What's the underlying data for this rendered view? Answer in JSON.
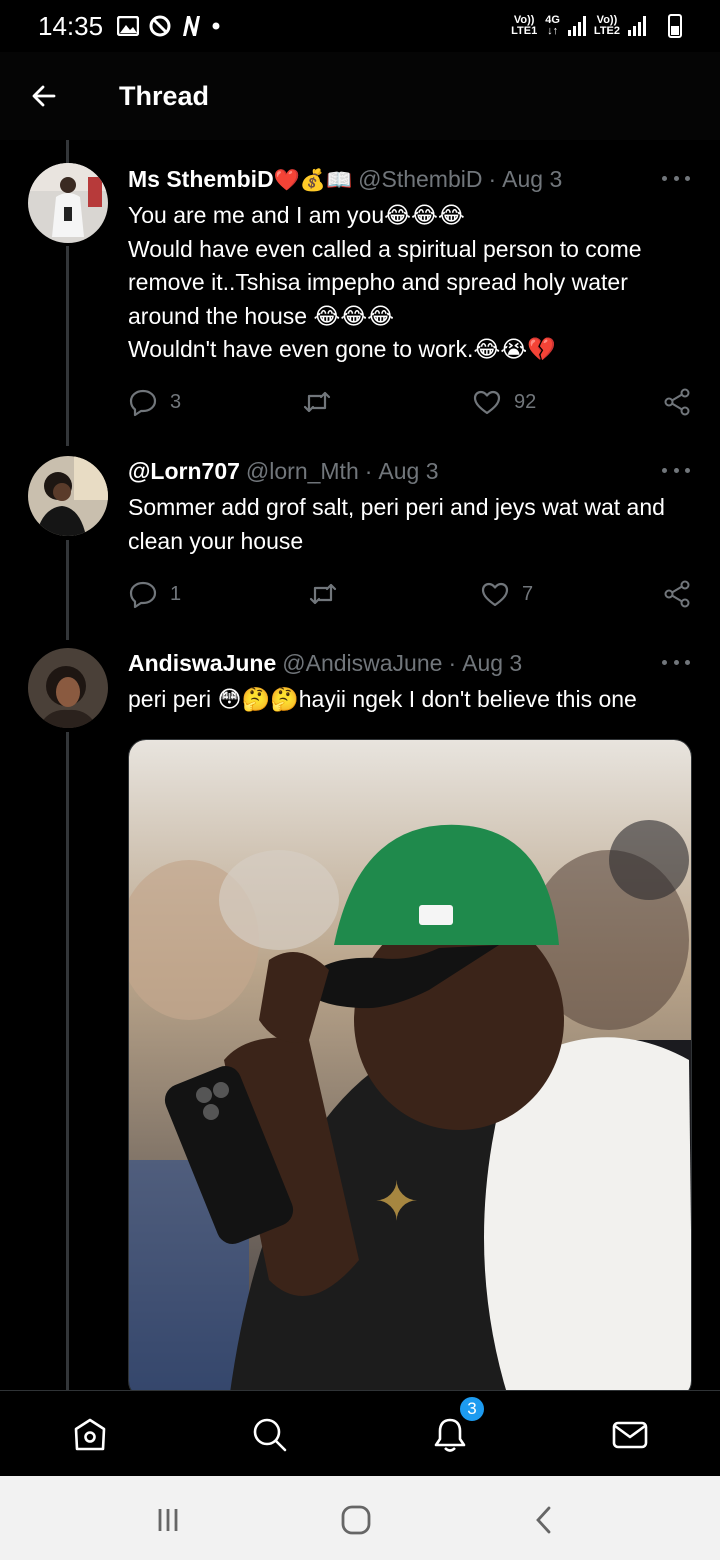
{
  "status_bar": {
    "time": "14:35",
    "sim1": {
      "top": "Vo))",
      "bottom": "LTE1"
    },
    "network": {
      "top": "4G",
      "bottom": "↓↑"
    },
    "sim2": {
      "top": "Vo))",
      "bottom": "LTE2"
    }
  },
  "header": {
    "title": "Thread"
  },
  "tweets": [
    {
      "name": "Ms SthembiD",
      "name_emojis": "❤️💰📖",
      "handle": "@SthembiD",
      "dot": "·",
      "date": "Aug 3",
      "lines": [
        "You are me and I am you😂😂😂",
        "Would have even called a spiritual person to come remove it..Tshisa impepho and spread holy water around the house 😂😂😂",
        "Wouldn't have even gone to work.😂😭💔"
      ],
      "replies": "3",
      "retweets": "",
      "likes": "92"
    },
    {
      "name": "@Lorn707",
      "handle": "@lorn_Mth",
      "dot": "·",
      "date": "Aug 3",
      "lines": [
        "Sommer add grof salt, peri peri and jeys wat wat and clean your house"
      ],
      "replies": "1",
      "retweets": "",
      "likes": "7"
    },
    {
      "name": "AndiswaJune",
      "handle": "@AndiswaJune",
      "dot": "·",
      "date": "Aug 3",
      "lines": [
        "peri peri 😳🤔🤔hayii ngek I don't believe this one"
      ]
    }
  ],
  "tabbar": {
    "notifications_badge": "3"
  },
  "icons": {
    "back": "arrow-left-icon",
    "more": "more-horizontal-icon",
    "reply": "reply-icon",
    "retweet": "retweet-icon",
    "like": "heart-icon",
    "share": "share-icon",
    "home": "home-icon",
    "search": "search-icon",
    "notifications": "bell-icon",
    "messages": "mail-icon"
  },
  "colors": {
    "background": "#000000",
    "accent": "#1d9bf0",
    "muted": "#71767b"
  }
}
